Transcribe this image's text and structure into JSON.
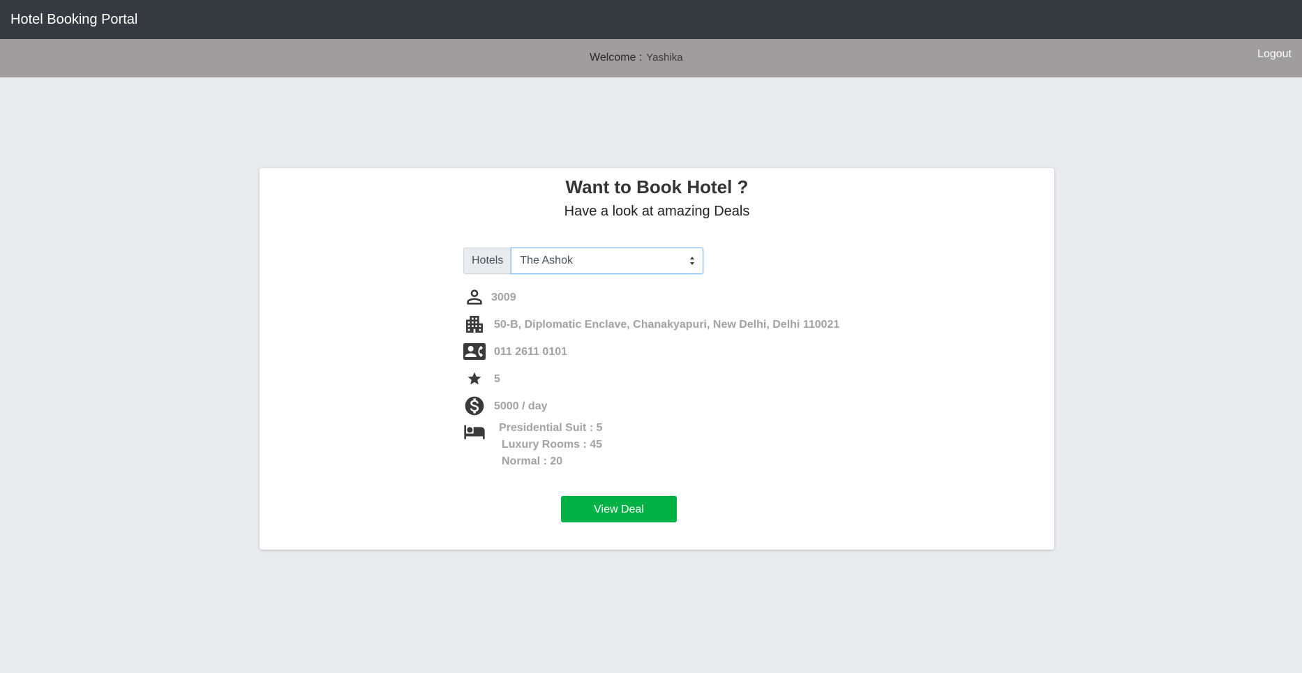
{
  "navbar": {
    "brand": "Hotel Booking Portal"
  },
  "welcome_bar": {
    "label": "Welcome :",
    "username": "Yashika",
    "logout": "Logout"
  },
  "card": {
    "title": "Want to Book Hotel ?",
    "subtitle": "Have a look at amazing Deals",
    "select": {
      "prepend": "Hotels",
      "value": "The Ashok"
    },
    "details": {
      "id": "3009",
      "address": "50-B, Diplomatic Enclave, Chanakyapuri, New Delhi, Delhi 110021",
      "phone": "011 2611 0101",
      "rating": "5",
      "price": "5000 / day",
      "rooms": [
        "Presidential Suit : 5",
        "Luxury Rooms : 45",
        "Normal : 20"
      ]
    },
    "button": "View Deal"
  },
  "icons": {
    "person": "person-icon",
    "building": "building-icon",
    "contact": "contact-phone-icon",
    "star": "star-icon",
    "money": "dollar-circle-icon",
    "bed": "bed-icon"
  },
  "colors": {
    "navbar_bg": "#343a40",
    "welcome_bg": "#9f9d9e",
    "page_bg": "#e9eaee",
    "button_bg": "#00b246",
    "detail_text": "#a2a2a2",
    "icon_color": "#3a3a3a"
  }
}
